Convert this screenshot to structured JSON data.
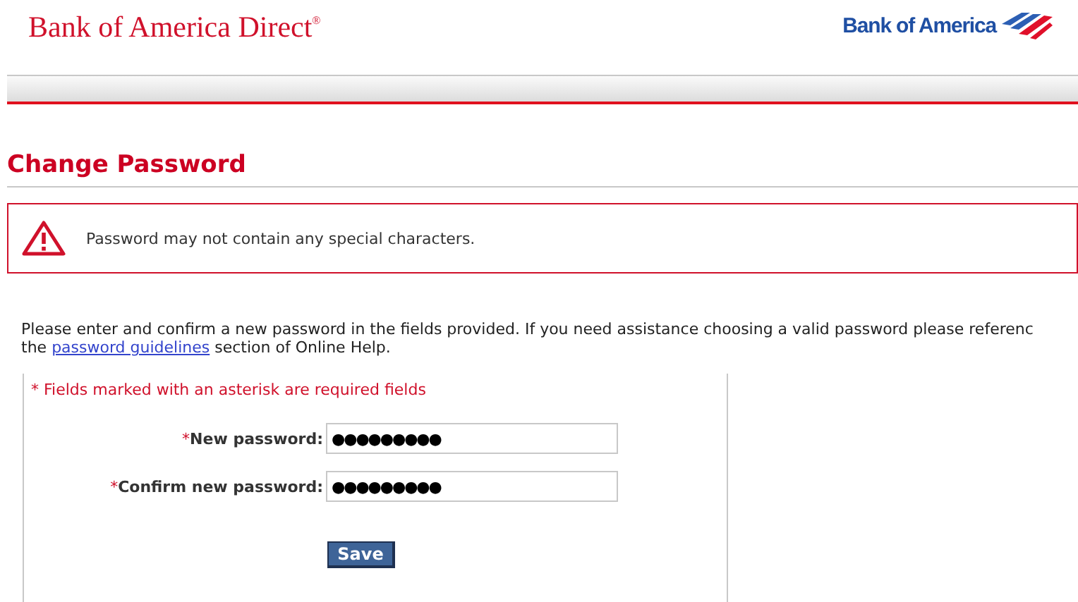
{
  "header": {
    "title": "Bank of America Direct",
    "title_mark": "®",
    "logo_text": "Bank of America"
  },
  "page": {
    "heading": "Change Password"
  },
  "alert": {
    "message": "Password may not contain any special characters."
  },
  "intro": {
    "line_1": "Please enter and confirm a new password in the fields provided. If you need assistance choosing a valid password please referenc",
    "before_link": "the ",
    "link": "password guidelines",
    "after_link": " section of Online Help."
  },
  "form": {
    "required_note": "* Fields marked with an asterisk are required fields",
    "fields": [
      {
        "asterisk": "*",
        "label": "New password:",
        "value": "●●●●●●●●●"
      },
      {
        "asterisk": "*",
        "label": "Confirm new password:",
        "value": "●●●●●●●●●"
      }
    ],
    "button": "Save"
  }
}
